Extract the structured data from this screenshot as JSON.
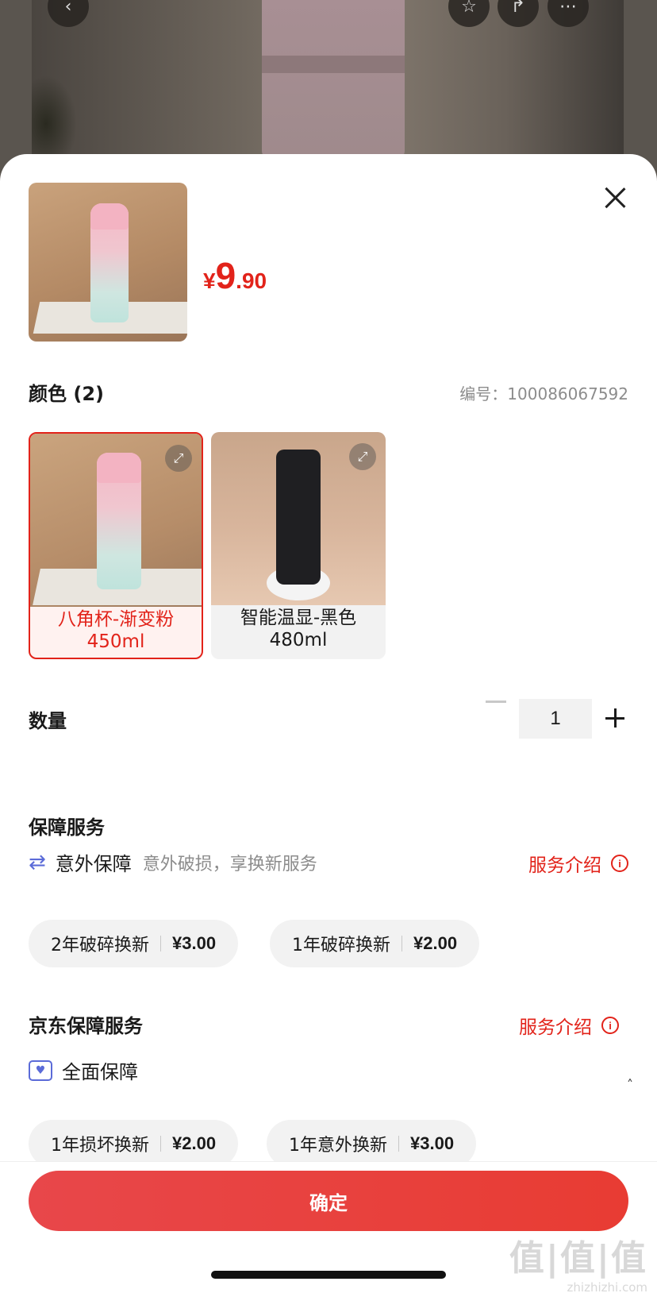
{
  "top_bar": {
    "back_icon": "chevron-left-icon",
    "actions": [
      "star-icon",
      "share-icon",
      "more-icon"
    ]
  },
  "product": {
    "price_symbol": "¥",
    "price_integer": "9",
    "price_decimal": ".90"
  },
  "color_section": {
    "title": "颜色 (2)",
    "sku_label": "编号：",
    "sku_value": "100086067592",
    "variants": [
      {
        "line1": "八角杯-渐变粉",
        "line2": "450ml",
        "selected": true
      },
      {
        "line1": "智能温显-黑色",
        "line2": "480ml",
        "selected": false
      }
    ]
  },
  "quantity": {
    "label": "数量",
    "value": "1"
  },
  "protection": {
    "title": "保障服务",
    "accident": {
      "name": "意外保障",
      "desc": "意外破损，享换新服务",
      "link": "服务介绍"
    },
    "options": [
      {
        "name": "2年破碎换新",
        "price": "¥3.00"
      },
      {
        "name": "1年破碎换新",
        "price": "¥2.00"
      }
    ]
  },
  "jd_protection": {
    "title": "京东保障服务",
    "link": "服务介绍",
    "full": {
      "name": "全面保障"
    },
    "options": [
      {
        "name": "1年损坏换新",
        "price": "¥2.00"
      },
      {
        "name": "1年意外换新",
        "price": "¥3.00"
      }
    ]
  },
  "footer": {
    "confirm": "确定"
  },
  "watermark": {
    "big": "值|值|值",
    "small": "zhizhizhi.com"
  },
  "colors": {
    "accent": "#e2231a",
    "button": "#e83c33"
  }
}
